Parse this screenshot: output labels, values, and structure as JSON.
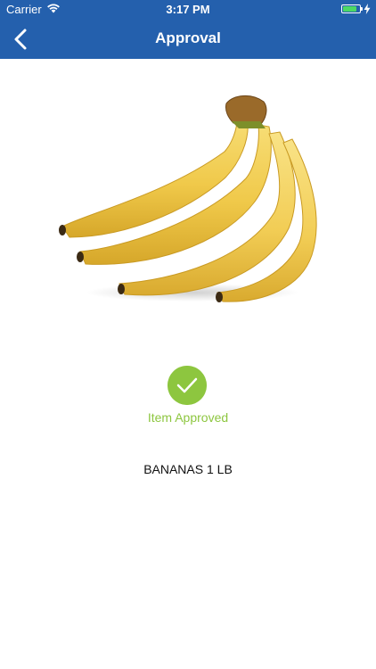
{
  "status_bar": {
    "carrier": "Carrier",
    "time": "3:17 PM",
    "wifi_icon": "wifi-icon",
    "battery_icon": "battery-charging-icon",
    "battery_level": 0.85
  },
  "nav": {
    "title": "Approval",
    "back_icon": "chevron-left-icon"
  },
  "product": {
    "image": "bananas-photo",
    "name": "BANANAS 1 LB"
  },
  "approval": {
    "icon": "checkmark-circle-icon",
    "label": "Item Approved"
  },
  "colors": {
    "nav_background": "#2460ad",
    "approved_green": "#8dc63f",
    "battery_green": "#4cd964"
  }
}
